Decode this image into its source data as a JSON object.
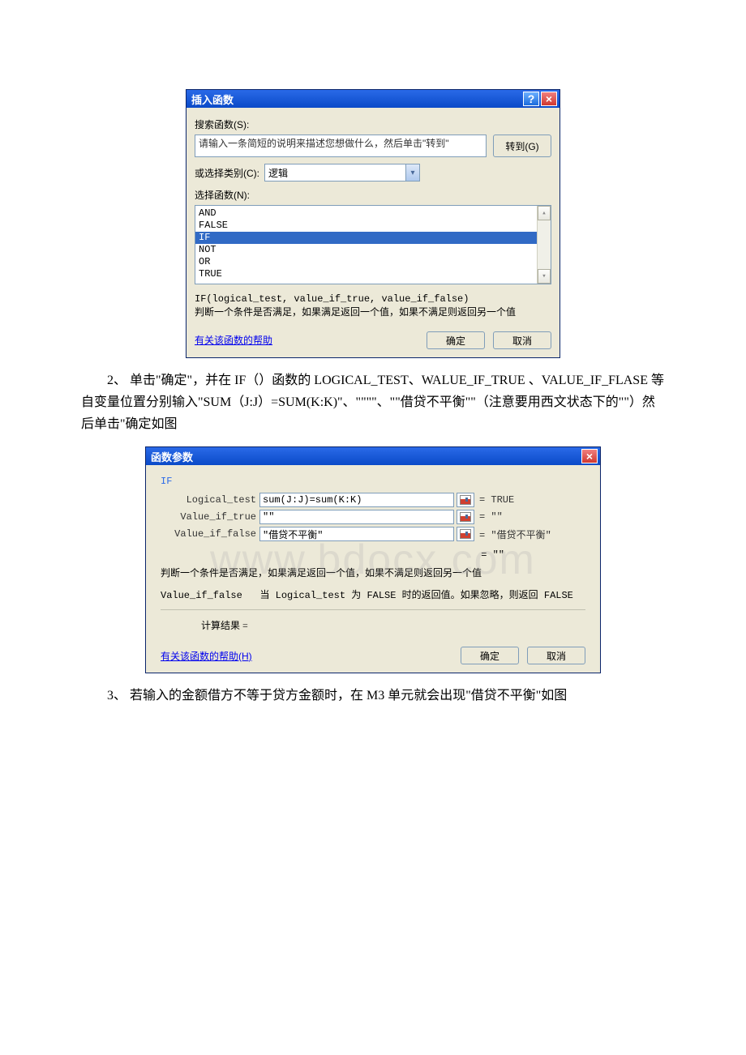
{
  "dialog1": {
    "title": "插入函数",
    "search_label": "搜索函数(S):",
    "search_placeholder": "请输入一条简短的说明来描述您想做什么，然后单击\"转到\"",
    "go_btn": "转到(G)",
    "category_label": "或选择类别(C):",
    "category_value": "逻辑",
    "select_label": "选择函数(N):",
    "functions": [
      "AND",
      "FALSE",
      "IF",
      "NOT",
      "OR",
      "TRUE"
    ],
    "selected_function": "IF",
    "syntax": "IF(logical_test, value_if_true, value_if_false)",
    "description": "判断一个条件是否满足，如果满足返回一个值，如果不满足则返回另一个值",
    "help_link": "有关该函数的帮助",
    "ok_btn": "确定",
    "cancel_btn": "取消"
  },
  "para1": "2、 单击\"确定\"，并在 IF（）函数的 LOGICAL_TEST、WALUE_IF_TRUE 、VALUE_IF_FLASE 等自变量位置分别输入\"SUM（J:J）=SUM(K:K)\"、\"\"\"\"、\"\"借贷不平衡\"\"（注意要用西文状态下的\"\"）然后单击\"确定如图",
  "dialog2": {
    "title": "函数参数",
    "fn_name": "IF",
    "rows": [
      {
        "label": "Logical_test",
        "value": "sum(J:J)=sum(K:K)",
        "result": "= TRUE"
      },
      {
        "label": "Value_if_true",
        "value": "\"\"",
        "result": "= \"\""
      },
      {
        "label": "Value_if_false",
        "value": "\"借贷不平衡\"",
        "result": "= \"借贷不平衡\""
      }
    ],
    "overall_result": "= \"\"",
    "description": "判断一个条件是否满足，如果满足返回一个值，如果不满足则返回另一个值",
    "arg_hint_label": "Value_if_false",
    "arg_hint": "当 Logical_test 为 FALSE 时的返回值。如果忽略，则返回 FALSE",
    "calc_label": "计算结果 =",
    "help_link": "有关该函数的帮助(H)",
    "ok_btn": "确定",
    "cancel_btn": "取消"
  },
  "para2": "3、 若输入的金额借方不等于贷方金额时，在 M3 单元就会出现\"借贷不平衡\"如图",
  "watermark": "www.bdocx.com"
}
